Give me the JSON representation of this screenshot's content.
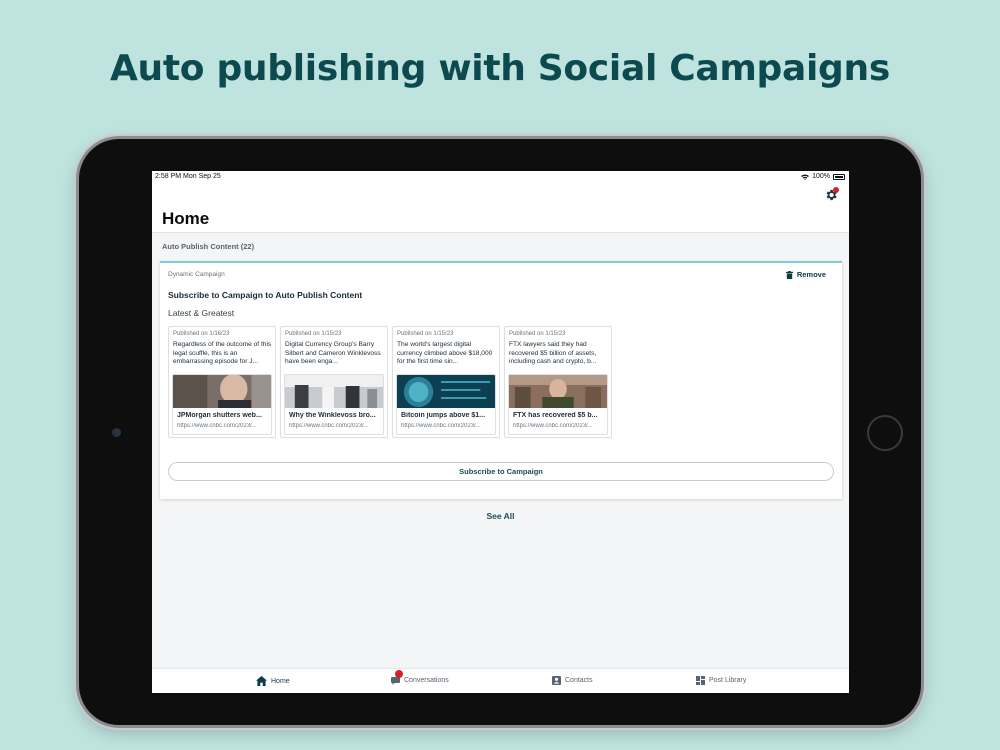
{
  "headline": "Auto publishing with Social Campaigns",
  "status_bar": {
    "time": "2:58 PM   Mon Sep 25",
    "battery": "100%"
  },
  "header": {
    "title": "Home"
  },
  "section": {
    "label": "Auto Publish Content (22)"
  },
  "campaign_card": {
    "kind": "Dynamic Campaign",
    "remove_label": "Remove",
    "title": "Subscribe to Campaign to Auto Publish Content",
    "subtitle": "Latest & Greatest",
    "posts": [
      {
        "published": "Published on 1/16/23",
        "description": "Regardless of the outcome of this legal scuffle, this is an embarrassing episode for J...",
        "title": "JPMorgan shutters web...",
        "url": "https://www.cnbc.com/2023/..."
      },
      {
        "published": "Published on 1/15/23",
        "description": "Digital Currency Group's Barry Silbert and Cameron Winklevoss have been enga...",
        "title": "Why the Winklevoss bro...",
        "url": "https://www.cnbc.com/2023/..."
      },
      {
        "published": "Published on 1/15/23",
        "description": "The world's largest digital currency climbed above $18,000 for the first time sin...",
        "title": "Bitcoin jumps above $1...",
        "url": "https://www.cnbc.com/2023/..."
      },
      {
        "published": "Published on 1/15/23",
        "description": "FTX lawyers said they had recovered $5 billion of assets, including cash and crypto, b...",
        "title": "FTX has recovered $5 b...",
        "url": "https://www.cnbc.com/2023/..."
      }
    ],
    "subscribe_label": "Subscribe to Campaign"
  },
  "see_all_label": "See All",
  "tabs": [
    {
      "label": "Home",
      "icon": "home-icon",
      "active": true
    },
    {
      "label": "Conversations",
      "icon": "chat-icon",
      "active": false
    },
    {
      "label": "Contacts",
      "icon": "contact-icon",
      "active": false
    },
    {
      "label": "Post Library",
      "icon": "library-icon",
      "active": false
    }
  ],
  "colors": {
    "background": "#bfe3df",
    "headline": "#0c4a4f",
    "accent": "#0f3d47",
    "badge": "#d0222b"
  }
}
